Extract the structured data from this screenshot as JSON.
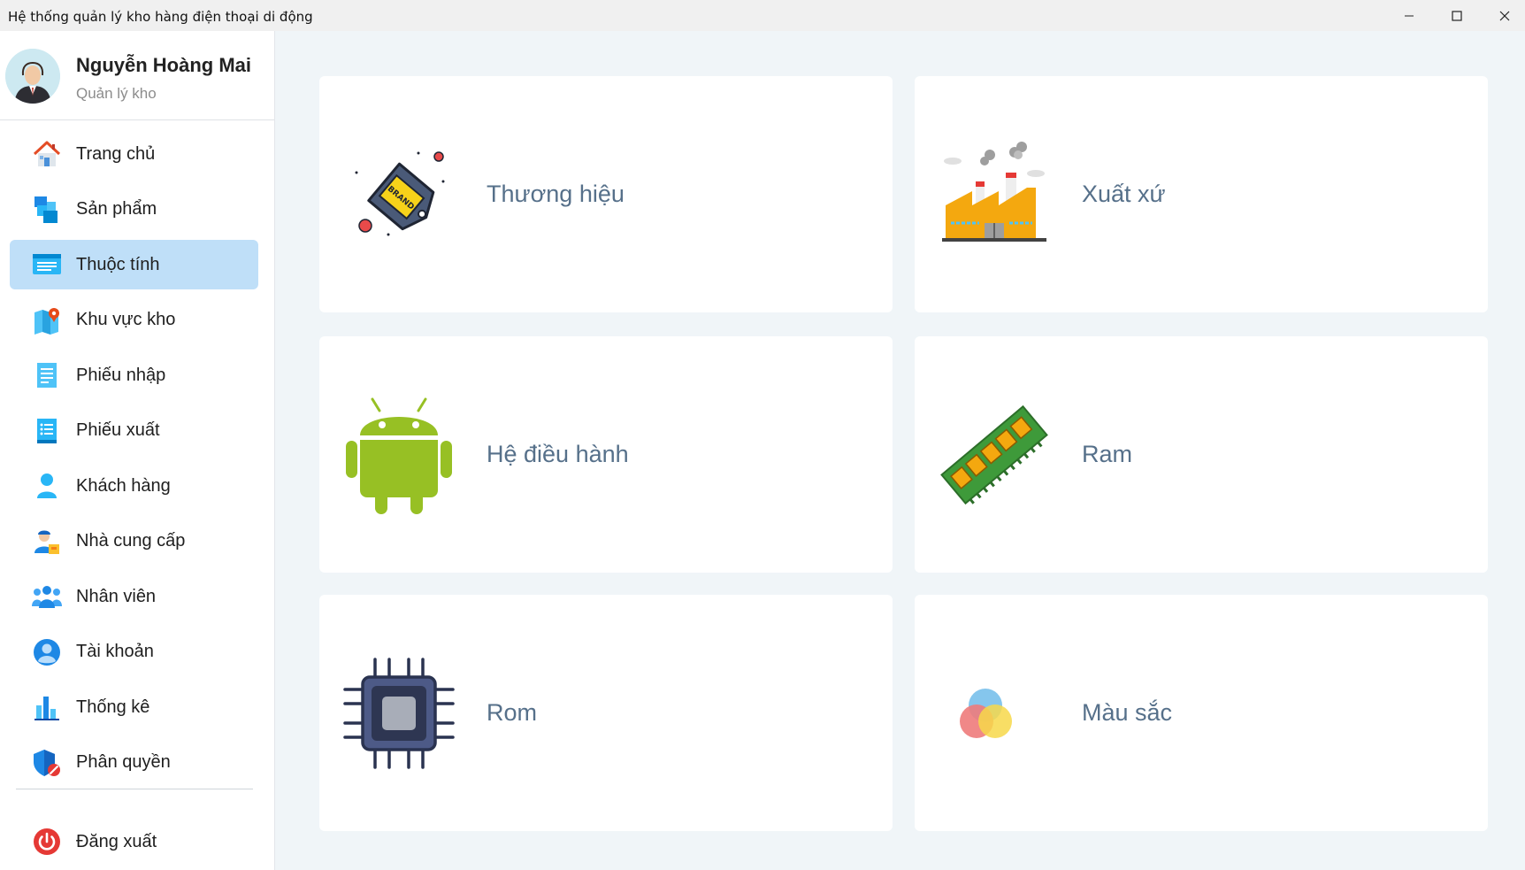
{
  "window": {
    "title": "Hệ thống quản lý kho hàng điện thoại di động"
  },
  "profile": {
    "name": "Nguyễn Hoàng Mai",
    "role": "Quản lý kho"
  },
  "sidebar": {
    "active_index": 2,
    "items": [
      {
        "label": "Trang chủ",
        "icon": "home-icon"
      },
      {
        "label": "Sản phẩm",
        "icon": "products-icon"
      },
      {
        "label": "Thuộc tính",
        "icon": "attributes-icon"
      },
      {
        "label": "Khu vực kho",
        "icon": "warehouse-map-icon"
      },
      {
        "label": "Phiếu nhập",
        "icon": "import-receipt-icon"
      },
      {
        "label": "Phiếu xuất",
        "icon": "export-receipt-icon"
      },
      {
        "label": "Khách hàng",
        "icon": "customer-icon"
      },
      {
        "label": "Nhà cung cấp",
        "icon": "supplier-icon"
      },
      {
        "label": "Nhân viên",
        "icon": "employees-icon"
      },
      {
        "label": "Tài khoản",
        "icon": "account-icon"
      },
      {
        "label": "Thống kê",
        "icon": "statistics-icon"
      },
      {
        "label": "Phân quyền",
        "icon": "permission-icon"
      }
    ],
    "logout_label": "Đăng xuất"
  },
  "cards": [
    {
      "label": "Thương hiệu",
      "icon": "brand-tag-icon"
    },
    {
      "label": "Xuất xứ",
      "icon": "factory-icon"
    },
    {
      "label": "Hệ điều hành",
      "icon": "android-icon"
    },
    {
      "label": "Ram",
      "icon": "ram-icon"
    },
    {
      "label": "Rom",
      "icon": "chip-icon"
    },
    {
      "label": "Màu sắc",
      "icon": "color-circles-icon"
    }
  ],
  "brand_tag_text": "BRAND",
  "colors": {
    "active_item_bg": "#bfdff8",
    "card_label": "#56708a",
    "main_bg": "#f0f5f8"
  }
}
